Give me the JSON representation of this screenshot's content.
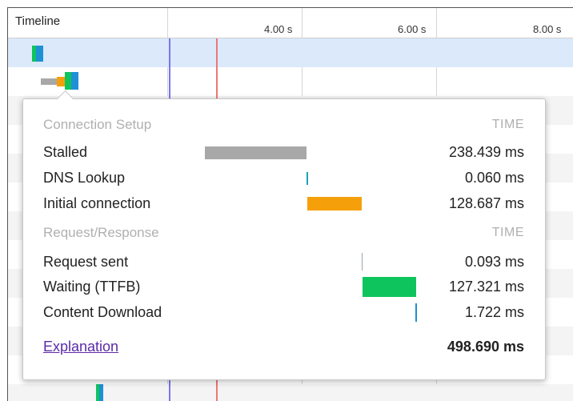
{
  "timeline": {
    "title": "Timeline",
    "ticks": [
      "4.00 s",
      "6.00 s",
      "8.00 s"
    ]
  },
  "popover": {
    "section1": {
      "title": "Connection Setup",
      "time_header": "TIME"
    },
    "section2": {
      "title": "Request/Response",
      "time_header": "TIME"
    },
    "rows": [
      {
        "label": "Stalled",
        "value": "238.439 ms",
        "color": "#a8a8a8"
      },
      {
        "label": "DNS Lookup",
        "value": "0.060 ms",
        "color": "#1aa3b8"
      },
      {
        "label": "Initial connection",
        "value": "128.687 ms",
        "color": "#f5a00a"
      },
      {
        "label": "Request sent",
        "value": "0.093 ms",
        "color": "#9aa6b0"
      },
      {
        "label": "Waiting (TTFB)",
        "value": "127.321 ms",
        "color": "#0ec45c"
      },
      {
        "label": "Content Download",
        "value": "1.722 ms",
        "color": "#1e90d6"
      }
    ],
    "explanation_link": "Explanation",
    "total": "498.690 ms"
  },
  "colors": {
    "blue_marker": "#7777ee",
    "red_marker": "#ee7777",
    "selected_row": "#dbe9fb"
  }
}
